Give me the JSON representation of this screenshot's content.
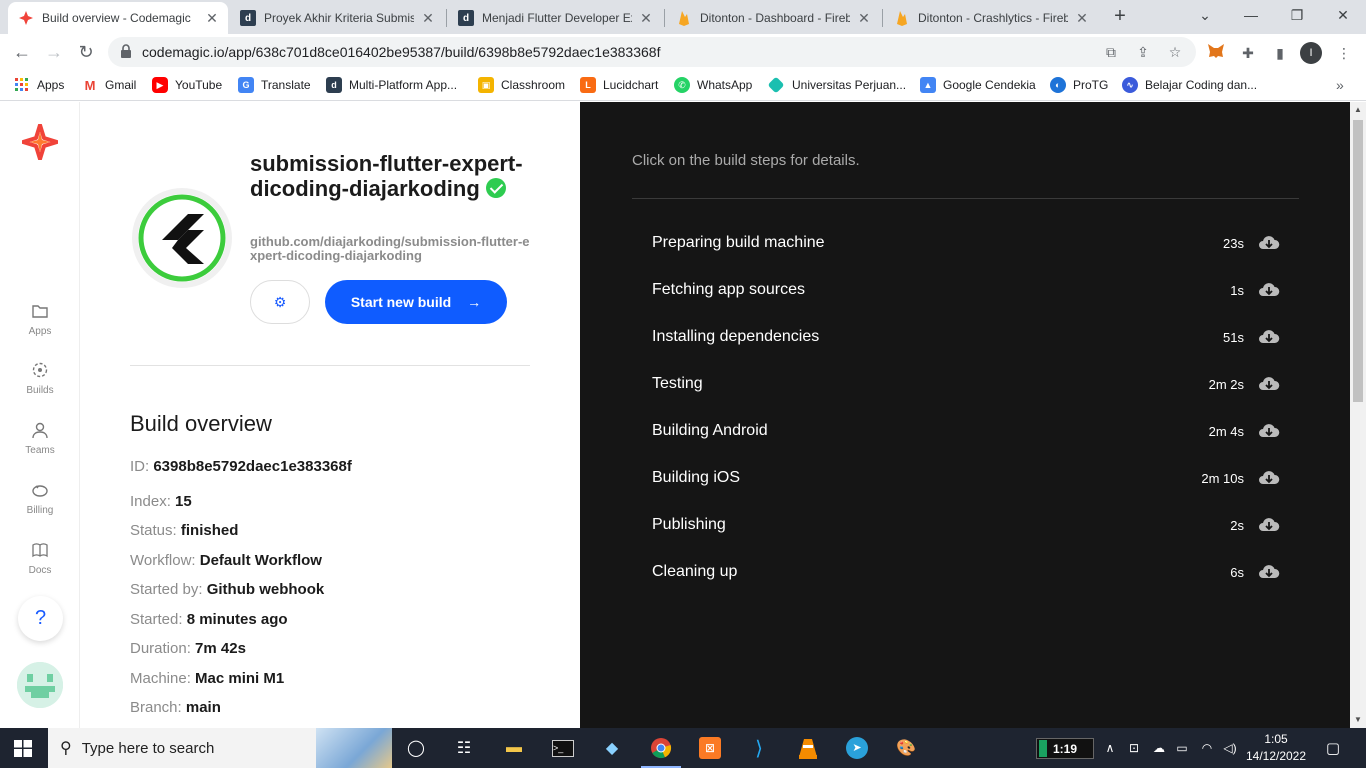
{
  "browser": {
    "tabs": [
      {
        "title": "Build overview - Codemagic",
        "active": true
      },
      {
        "title": "Proyek Akhir Kriteria Submiss",
        "active": false
      },
      {
        "title": "Menjadi Flutter Developer Ex",
        "active": false
      },
      {
        "title": "Ditonton - Dashboard - Fireb",
        "active": false
      },
      {
        "title": "Ditonton - Crashlytics - Fireb",
        "active": false
      }
    ],
    "new_tab": "+",
    "url": "codemagic.io/app/638c701d8ce016402be95387/build/6398b8e5792daec1e383368f",
    "profile_initial": "I"
  },
  "bookmarks": [
    {
      "label": "Apps",
      "icon": "apps-grid-icon"
    },
    {
      "label": "Gmail",
      "icon": "gmail-icon"
    },
    {
      "label": "YouTube",
      "icon": "youtube-icon"
    },
    {
      "label": "Translate",
      "icon": "translate-icon"
    },
    {
      "label": "Multi-Platform App...",
      "icon": "dicoding-icon"
    },
    {
      "label": "Classhroom",
      "icon": "classroom-icon"
    },
    {
      "label": "Lucidchart",
      "icon": "lucidchart-icon"
    },
    {
      "label": "WhatsApp",
      "icon": "whatsapp-icon"
    },
    {
      "label": "Universitas Perjuan...",
      "icon": "university-icon"
    },
    {
      "label": "Google Cendekia",
      "icon": "scholar-icon"
    },
    {
      "label": "ProTG",
      "icon": "protg-icon"
    },
    {
      "label": "Belajar Coding dan...",
      "icon": "belajar-icon"
    }
  ],
  "sidebar": {
    "items": [
      {
        "label": "Apps"
      },
      {
        "label": "Builds"
      },
      {
        "label": "Teams"
      },
      {
        "label": "Billing"
      },
      {
        "label": "Docs"
      }
    ],
    "help": "?"
  },
  "app": {
    "title": "submission-flutter-expert-dicoding-diajarkoding",
    "repo": "github.com/diajarkoding/submission-flutter-expert-dicoding-diajarkoding",
    "start_build_label": "Start new build"
  },
  "overview": {
    "heading": "Build overview",
    "rows": [
      {
        "label": "ID:",
        "value": "6398b8e5792daec1e383368f"
      },
      {
        "label": "Index:",
        "value": "15"
      },
      {
        "label": "Status:",
        "value": "finished"
      },
      {
        "label": "Workflow:",
        "value": "Default Workflow"
      },
      {
        "label": "Started by:",
        "value": "Github webhook"
      },
      {
        "label": "Started:",
        "value": "8 minutes ago"
      },
      {
        "label": "Duration:",
        "value": "7m 42s"
      },
      {
        "label": "Machine:",
        "value": "Mac mini M1"
      },
      {
        "label": "Branch:",
        "value": "main"
      }
    ]
  },
  "steps_panel": {
    "hint": "Click on the build steps for details.",
    "steps": [
      {
        "name": "Preparing build machine",
        "duration": "23s"
      },
      {
        "name": "Fetching app sources",
        "duration": "1s"
      },
      {
        "name": "Installing dependencies",
        "duration": "51s"
      },
      {
        "name": "Testing",
        "duration": "2m 2s"
      },
      {
        "name": "Building Android",
        "duration": "2m 4s"
      },
      {
        "name": "Building iOS",
        "duration": "2m 10s"
      },
      {
        "name": "Publishing",
        "duration": "2s"
      },
      {
        "name": "Cleaning up",
        "duration": "6s"
      }
    ]
  },
  "taskbar": {
    "search_placeholder": "Type here to search",
    "battery_time": "1:19",
    "time": "1:05",
    "date": "14/12/2022"
  },
  "colors": {
    "accent": "#0f5cff",
    "success": "#2ecc50",
    "dark_panel": "#151515"
  }
}
